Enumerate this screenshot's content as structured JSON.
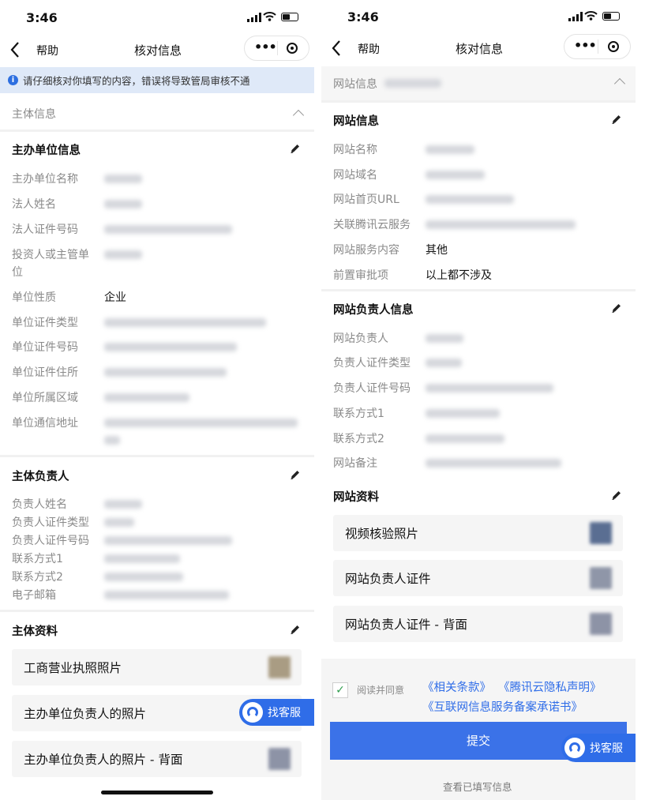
{
  "status": {
    "time": "3:46"
  },
  "nav": {
    "back_label": "帮助",
    "title": "核对信息"
  },
  "left": {
    "notice": "请仔细核对你填写的内容，错误将导致管局审核不通",
    "collapse_header": "主体信息",
    "sponsor": {
      "title": "主办单位信息",
      "rows": [
        {
          "label": "主办单位名称",
          "value": ""
        },
        {
          "label": "法人姓名",
          "value": ""
        },
        {
          "label": "法人证件号码",
          "value": ""
        },
        {
          "label": "投资人或主管单",
          "label2": "位",
          "value": ""
        },
        {
          "label": "单位性质",
          "value": "企业"
        },
        {
          "label": "单位证件类型",
          "value": ""
        },
        {
          "label": "单位证件号码",
          "value": ""
        },
        {
          "label": "单位证件住所",
          "value": ""
        },
        {
          "label": "单位所属区域",
          "value": ""
        },
        {
          "label": "单位通信地址",
          "value": ""
        }
      ]
    },
    "principal": {
      "title": "主体负责人",
      "rows": [
        {
          "label": "负责人姓名"
        },
        {
          "label": "负责人证件类型"
        },
        {
          "label": "负责人证件号码"
        },
        {
          "label": "联系方式1"
        },
        {
          "label": "联系方式2"
        },
        {
          "label": "电子邮箱"
        }
      ]
    },
    "materials": {
      "title": "主体资料",
      "cards": [
        {
          "label": "工商营业执照照片"
        },
        {
          "label": "主办单位负责人的照片"
        },
        {
          "label": "主办单位负责人的照片 - 背面"
        }
      ]
    },
    "float_service": "找客服"
  },
  "right": {
    "collapse_header": "网站信息",
    "website": {
      "title": "网站信息",
      "rows": [
        {
          "label": "网站名称",
          "value": ""
        },
        {
          "label": "网站域名",
          "value": ""
        },
        {
          "label": "网站首页URL",
          "value": ""
        },
        {
          "label": "关联腾讯云服务",
          "value": ""
        },
        {
          "label": "网站服务内容",
          "value": "其他"
        },
        {
          "label": "前置审批项",
          "value": "以上都不涉及"
        }
      ]
    },
    "site_owner": {
      "title": "网站负责人信息",
      "rows": [
        {
          "label": "网站负责人"
        },
        {
          "label": "负责人证件类型"
        },
        {
          "label": "负责人证件号码"
        },
        {
          "label": "联系方式1"
        },
        {
          "label": "联系方式2"
        },
        {
          "label": "网站备注"
        }
      ]
    },
    "site_materials": {
      "title": "网站资料",
      "cards": [
        {
          "label": "视频核验照片"
        },
        {
          "label": "网站负责人证件"
        },
        {
          "label": "网站负责人证件 - 背面"
        }
      ]
    },
    "agree": {
      "text": "阅读并同意",
      "link1": "《相关条款》",
      "link2": "《腾讯云隐私声明》",
      "link3": "《互联网信息服务备案承诺书》"
    },
    "submit": "提交",
    "view_filled": "查看已填写信息",
    "float_service": "找客服"
  },
  "colors": {
    "accent": "#2f6de8",
    "notice_bg": "#dfe9f8"
  },
  "icons": [
    "info-icon",
    "pencil-icon",
    "chevron-up-icon",
    "back-arrow-icon",
    "more-icon",
    "record-icon",
    "customer-service-icon",
    "checkmark-icon"
  ]
}
